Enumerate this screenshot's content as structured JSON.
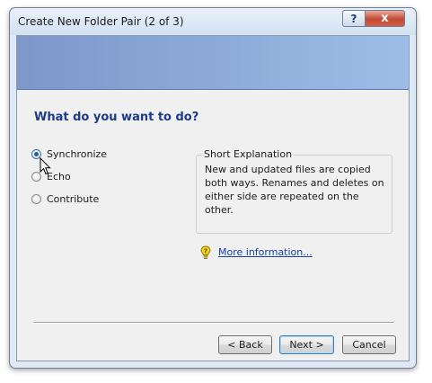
{
  "window": {
    "title": "Create New Folder Pair (2 of 3)",
    "help_button": "?",
    "close_button": "x"
  },
  "main": {
    "question": "What do you want to do?",
    "options": [
      {
        "label": "Synchronize",
        "selected": true
      },
      {
        "label": "Echo",
        "selected": false
      },
      {
        "label": "Contribute",
        "selected": false
      }
    ],
    "explanation_title": "Short Explanation",
    "explanation_text": "New and updated files are copied both ways. Renames and deletes on either side are repeated on the other.",
    "more_info_link": "More information..."
  },
  "footer": {
    "back_label": "< Back",
    "next_label": "Next >",
    "cancel_label": "Cancel"
  },
  "colors": {
    "banner": "#89a6d4",
    "question_text": "#1e3a8a",
    "link": "#1a3fa0"
  }
}
